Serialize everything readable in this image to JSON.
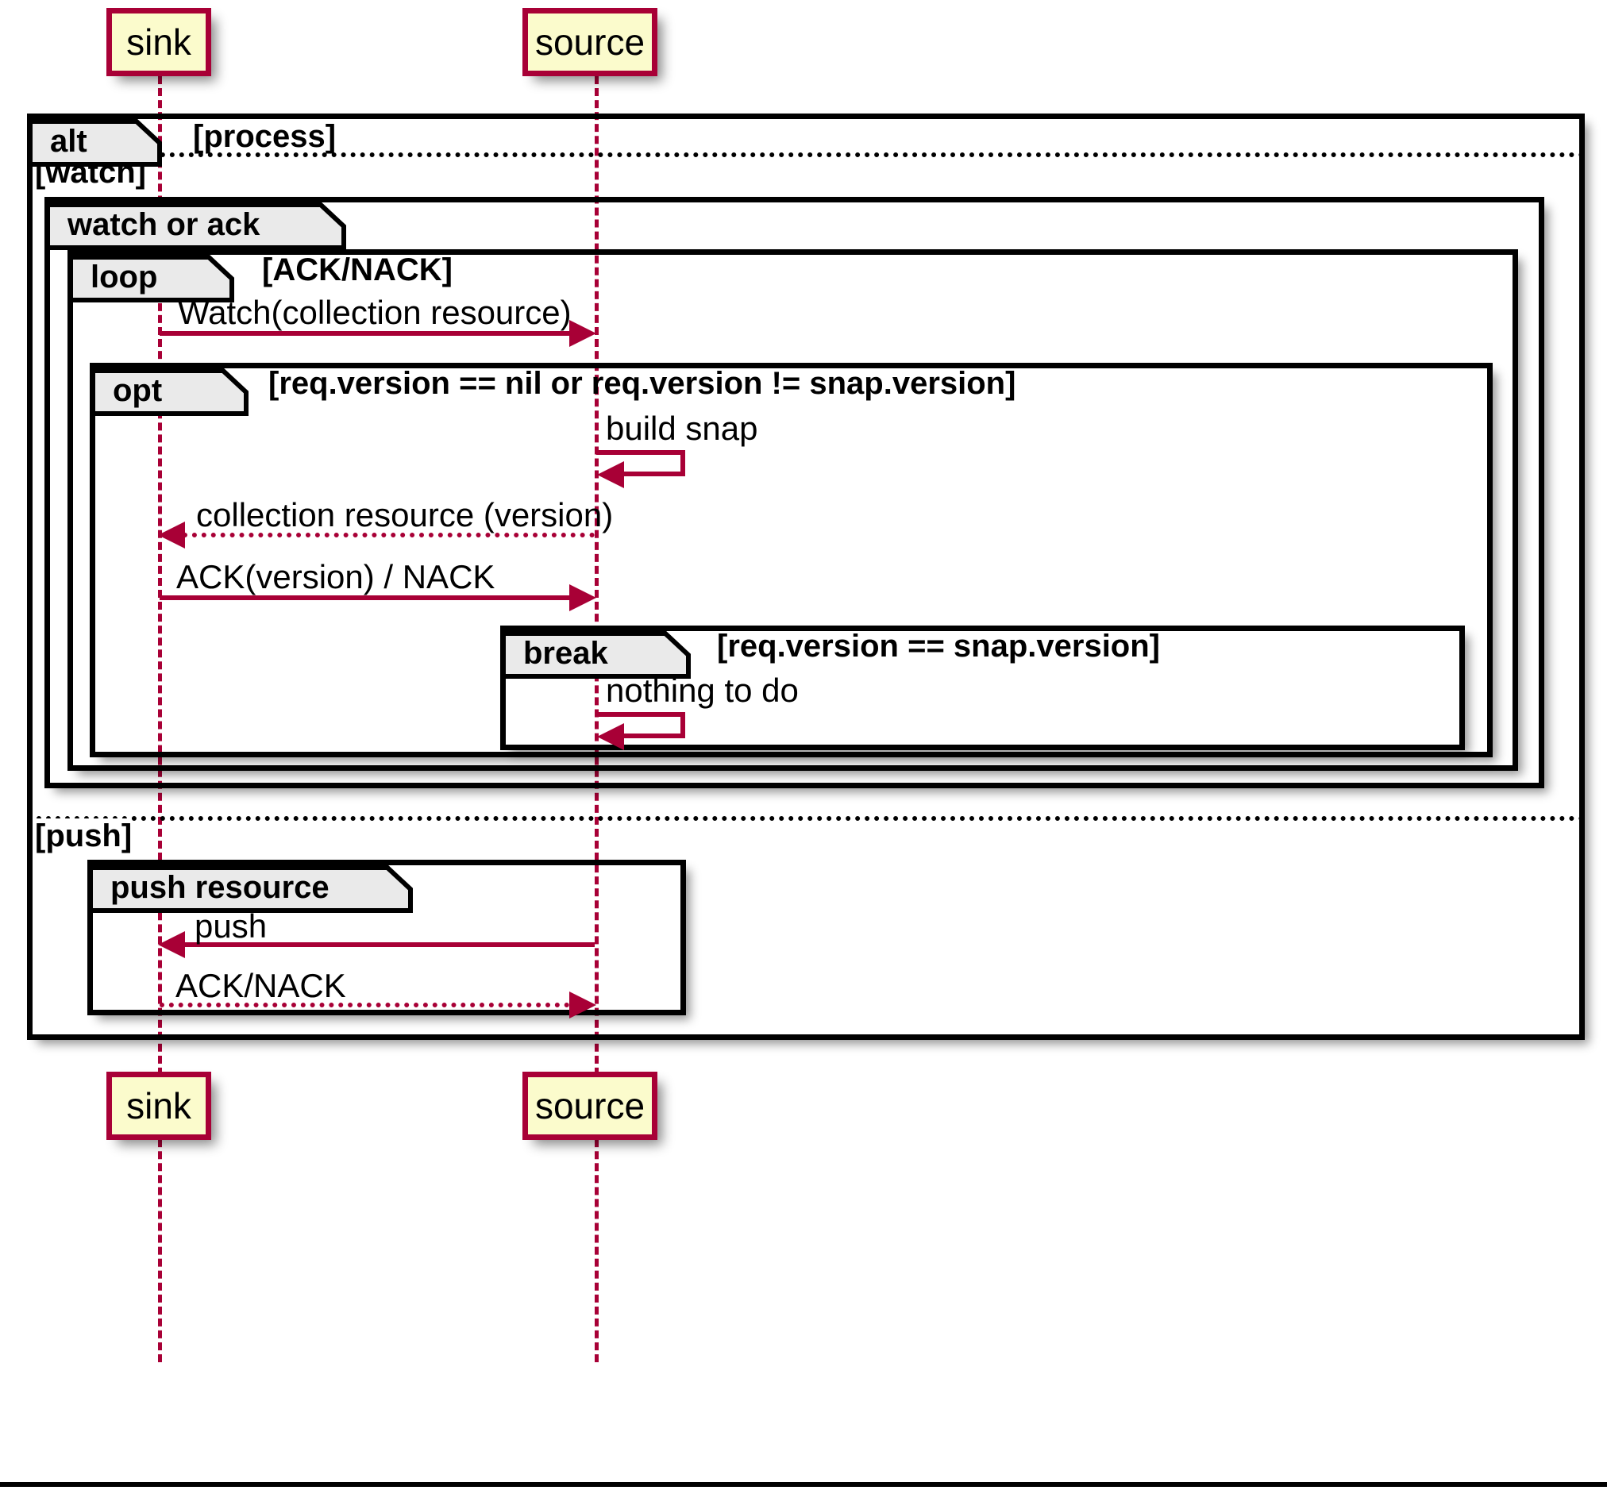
{
  "diagram": {
    "type": "uml-sequence-diagram",
    "colors": {
      "participant_fill": "#FBFBCC",
      "participant_border": "#A80036",
      "message_color": "#A80036",
      "fragment_border": "#000000",
      "fragment_tab_fill": "#EAEAEA",
      "background": "#FFFFFF"
    }
  },
  "participants": [
    {
      "id": "sink",
      "label": "sink"
    },
    {
      "id": "source",
      "label": "source"
    }
  ],
  "participants_bottom": [
    {
      "id": "sink",
      "label": "sink"
    },
    {
      "id": "source",
      "label": "source"
    }
  ],
  "fragments": {
    "alt": {
      "operator": "alt",
      "condition": "[process]",
      "guards": [
        "[watch]",
        "[push]"
      ]
    },
    "watch_or_ack": {
      "operator": "watch or ack",
      "condition": ""
    },
    "loop": {
      "operator": "loop",
      "condition": "[ACK/NACK]"
    },
    "opt": {
      "operator": "opt",
      "condition": "[req.version == nil or req.version != snap.version]"
    },
    "break": {
      "operator": "break",
      "condition": "[req.version == snap.version]"
    },
    "push_resource": {
      "operator": "push resource",
      "condition": ""
    }
  },
  "messages": [
    {
      "id": "m1",
      "label": "Watch(collection resource)",
      "from": "sink",
      "to": "source",
      "style": "solid",
      "direction": "right"
    },
    {
      "id": "m2",
      "label": "build snap",
      "from": "source",
      "to": "source",
      "style": "solid",
      "direction": "self"
    },
    {
      "id": "m3",
      "label": "collection resource (version)",
      "from": "source",
      "to": "sink",
      "style": "dotted",
      "direction": "left"
    },
    {
      "id": "m4",
      "label": "ACK(version) / NACK",
      "from": "sink",
      "to": "source",
      "style": "solid",
      "direction": "right"
    },
    {
      "id": "m5",
      "label": "nothing to do",
      "from": "source",
      "to": "source",
      "style": "solid",
      "direction": "self"
    },
    {
      "id": "m6",
      "label": "push",
      "from": "source",
      "to": "sink",
      "style": "solid",
      "direction": "left"
    },
    {
      "id": "m7",
      "label": "ACK/NACK",
      "from": "sink",
      "to": "source",
      "style": "dotted",
      "direction": "right"
    }
  ]
}
